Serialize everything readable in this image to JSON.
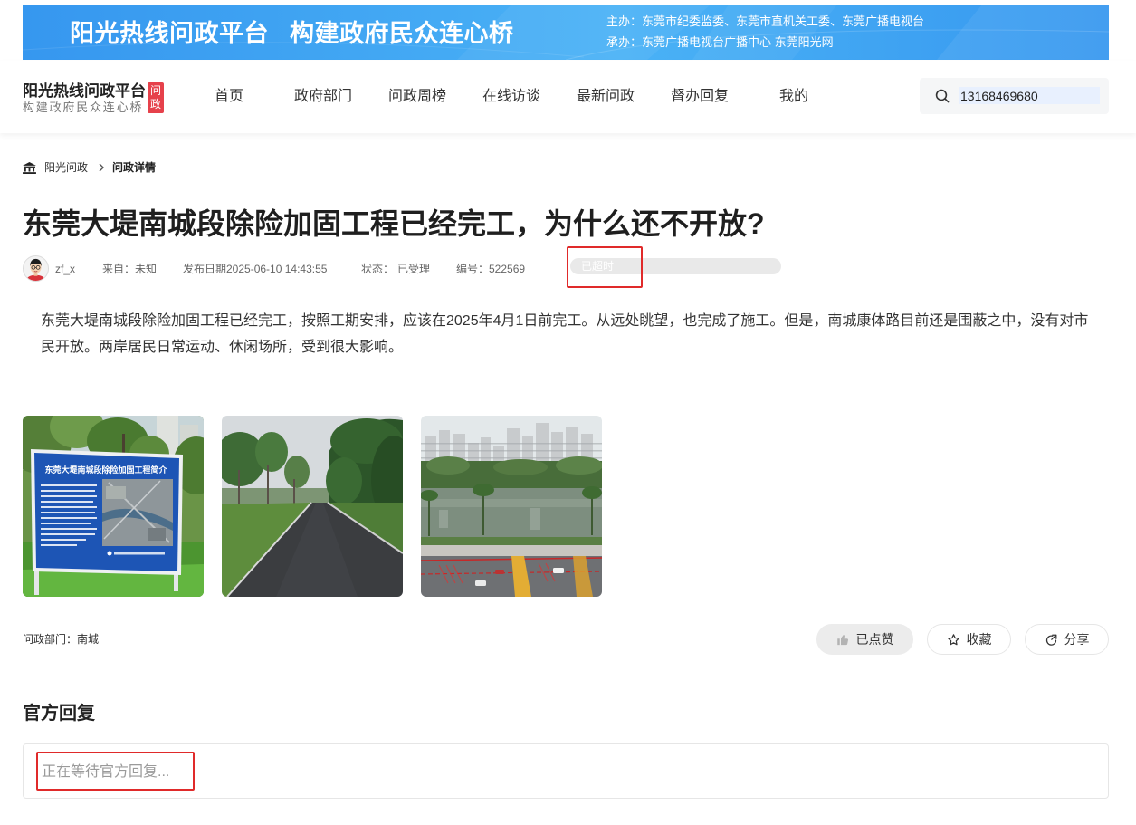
{
  "colors": {
    "banner_start": "#3697ef",
    "banner_end": "#4ab2f6",
    "badge": "#e6414b",
    "annotation": "#e02a2a",
    "liked_button": "#ececec"
  },
  "banner": {
    "title": "阳光热线问政平台",
    "slogan": "构建政府民众连心桥",
    "host": "主办：东莞市纪委监委、东莞市直机关工委、东莞广播电视台",
    "organizer": "承办：东莞广播电视台广播中心 东莞阳光网"
  },
  "header": {
    "logo": {
      "title": "阳光热线问政平台",
      "badge_top": "问",
      "badge_bottom": "政",
      "subtitle": "构建政府民众连心桥"
    },
    "nav": [
      {
        "label": "首页"
      },
      {
        "label": "政府部门"
      },
      {
        "label": "问政周榜"
      },
      {
        "label": "在线访谈"
      },
      {
        "label": "最新问政"
      },
      {
        "label": "督办回复"
      },
      {
        "label": "我的"
      }
    ],
    "search": {
      "icon": "search-icon",
      "value": "13168469680"
    }
  },
  "breadcrumb": {
    "home_icon": "home-icon",
    "separator_icon": "chevron-right-icon",
    "root": "阳光问政",
    "current": "问政详情"
  },
  "question": {
    "title": "东莞大堤南城段除险加固工程已经完工，为什么还不开放?",
    "author": "zf_x",
    "source": "来自：未知",
    "published": "发布日期2025-06-10 14:43:55",
    "status_label": "状态：",
    "status": "已受理",
    "number": "编号：522569",
    "deadline_state": "已超时",
    "body": "东莞大堤南城段除险加固工程已经完工，按照工期安排，应该在2025年4月1日前完工。从远处眺望，也完成了施工。但是，南城康体路目前还是围蔽之中，没有对市民开放。两岸居民日常运动、休闲场所，受到很大影响。",
    "photo_sign_title": "东莞大堤南城段除险加固工程简介",
    "department": "问政部门：南城"
  },
  "actions": {
    "like": {
      "label": "已点赞",
      "icon": "thumbs-up-icon"
    },
    "favorite": {
      "label": "收藏",
      "icon": "star-icon"
    },
    "share": {
      "label": "分享",
      "icon": "share-icon"
    }
  },
  "reply": {
    "heading": "官方回复",
    "waiting_text": "正在等待官方回复..."
  }
}
